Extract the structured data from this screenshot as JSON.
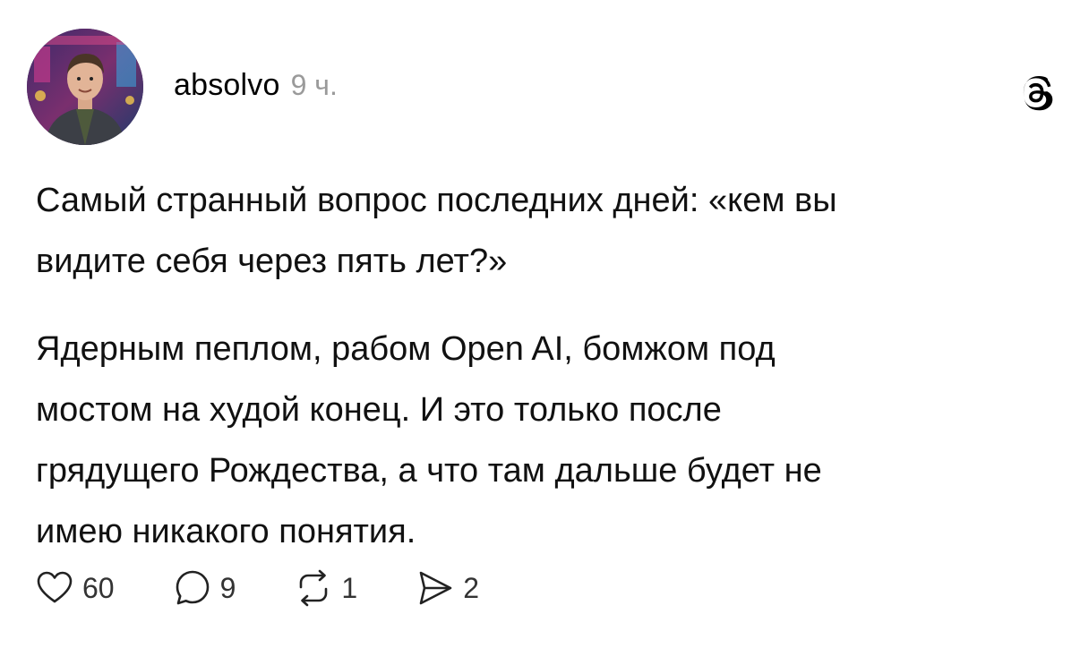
{
  "post": {
    "author": {
      "username": "absolvo",
      "time": "9 ч.",
      "avatar_icon": "person-photo"
    },
    "platform_icon": "threads-logo-icon",
    "paragraphs": [
      "Самый странный вопрос последних дней: «кем вы\nвидите себя через пять лет?»",
      "Ядерным пеплом, рабом Open AI, бомжом под\nмостом на худой конец. И это только после\nгрядущего Рождества, а что там дальше будет не\nимею никакого понятия."
    ],
    "actions": {
      "likes": {
        "icon": "heart-icon",
        "count": "60"
      },
      "comments": {
        "icon": "comment-icon",
        "count": "9"
      },
      "reposts": {
        "icon": "repost-icon",
        "count": "1"
      },
      "shares": {
        "icon": "send-icon",
        "count": "2"
      }
    }
  }
}
